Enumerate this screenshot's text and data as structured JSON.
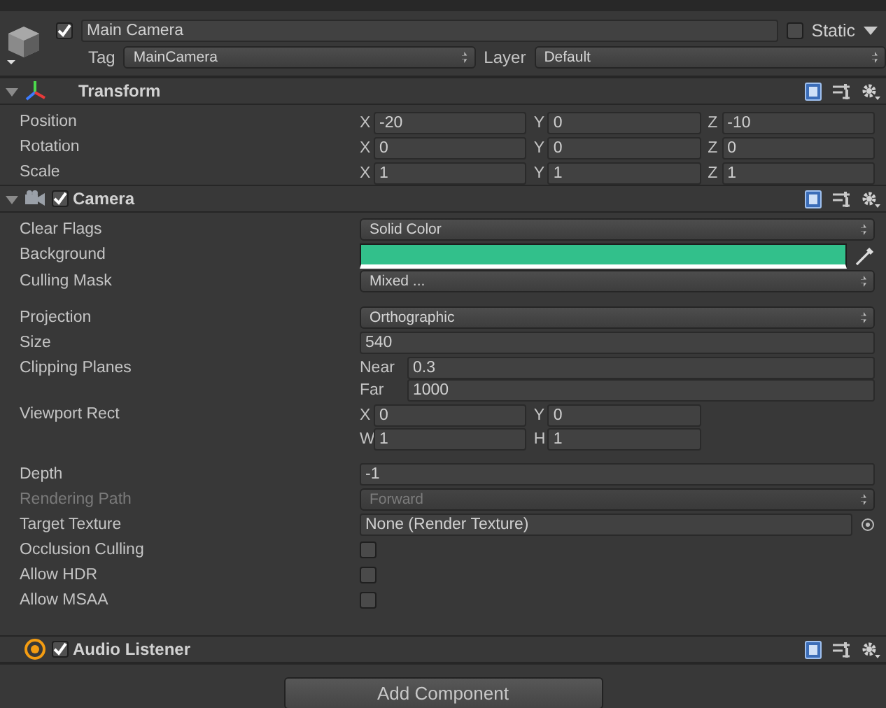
{
  "game_object": {
    "enabled": true,
    "name": "Main Camera",
    "static_label": "Static",
    "static": false,
    "tag_label": "Tag",
    "tag": "MainCamera",
    "layer_label": "Layer",
    "layer": "Default"
  },
  "components": [
    {
      "kind": "transform",
      "title": "Transform",
      "expanded": true,
      "properties": [
        {
          "kind": "vector",
          "label": "Position",
          "fields": [
            {
              "axis": "X",
              "value": "-20"
            },
            {
              "axis": "Y",
              "value": "0"
            },
            {
              "axis": "Z",
              "value": "-10"
            }
          ]
        },
        {
          "kind": "vector",
          "label": "Rotation",
          "fields": [
            {
              "axis": "X",
              "value": "0"
            },
            {
              "axis": "Y",
              "value": "0"
            },
            {
              "axis": "Z",
              "value": "0"
            }
          ]
        },
        {
          "kind": "vector",
          "label": "Scale",
          "fields": [
            {
              "axis": "X",
              "value": "1"
            },
            {
              "axis": "Y",
              "value": "1"
            },
            {
              "axis": "Z",
              "value": "1"
            }
          ]
        }
      ]
    },
    {
      "kind": "camera",
      "title": "Camera",
      "expanded": true,
      "enabled": true,
      "properties": [
        {
          "kind": "dropdown",
          "label": "Clear Flags",
          "value": "Solid Color",
          "disabled": false
        },
        {
          "kind": "color",
          "label": "Background",
          "color": "#32c08b"
        },
        {
          "kind": "dropdown",
          "label": "Culling Mask",
          "value": "Mixed ...",
          "disabled": false
        },
        {
          "kind": "spacer"
        },
        {
          "kind": "dropdown",
          "label": "Projection",
          "value": "Orthographic",
          "disabled": false
        },
        {
          "kind": "text",
          "label": "Size",
          "value": "540"
        },
        {
          "kind": "planes",
          "label": "Clipping Planes",
          "fields": [
            {
              "name": "Near",
              "value": "0.3"
            },
            {
              "name": "Far",
              "value": "1000"
            }
          ]
        },
        {
          "kind": "rect",
          "label": "Viewport Rect",
          "fields": [
            {
              "axis": "X",
              "value": "0"
            },
            {
              "axis": "Y",
              "value": "0"
            },
            {
              "axis": "W",
              "value": "1"
            },
            {
              "axis": "H",
              "value": "1"
            }
          ]
        },
        {
          "kind": "spacer"
        },
        {
          "kind": "text",
          "label": "Depth",
          "value": "-1"
        },
        {
          "kind": "dropdown",
          "label": "Rendering Path",
          "value": "Forward",
          "disabled": true
        },
        {
          "kind": "object",
          "label": "Target Texture",
          "value": "None (Render Texture)"
        },
        {
          "kind": "checkbox",
          "label": "Occlusion Culling",
          "checked": false
        },
        {
          "kind": "checkbox",
          "label": "Allow HDR",
          "checked": false
        },
        {
          "kind": "checkbox",
          "label": "Allow MSAA",
          "checked": false
        },
        {
          "kind": "spacer"
        }
      ]
    },
    {
      "kind": "audio",
      "title": "Audio Listener",
      "enabled": true
    }
  ],
  "add_button": "Add Component"
}
